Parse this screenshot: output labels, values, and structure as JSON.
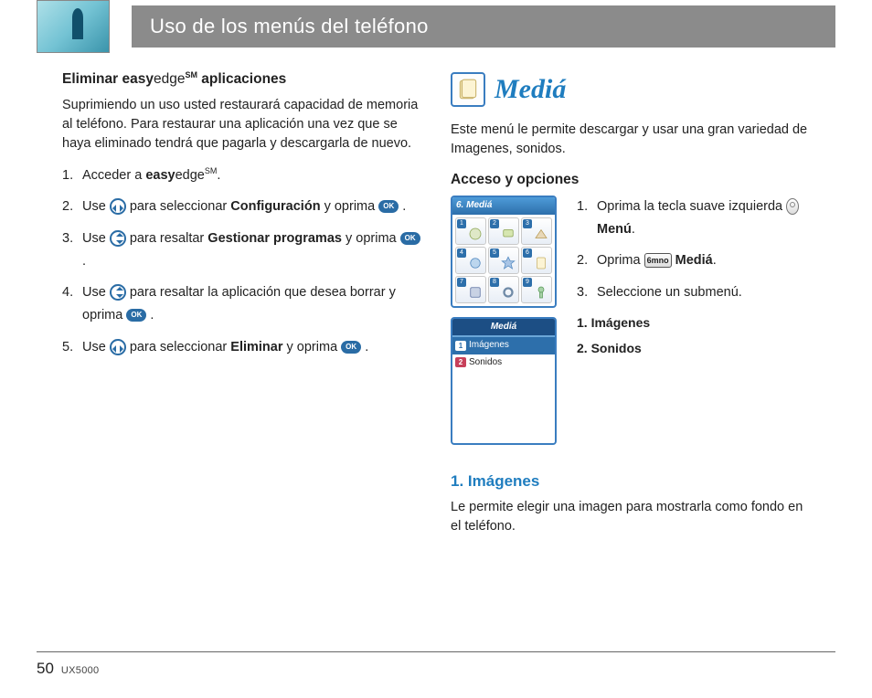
{
  "header": {
    "title": "Uso de los menús del teléfono"
  },
  "left": {
    "heading_pre": "Eliminar ",
    "heading_bold": "easy",
    "heading_light": "edge",
    "heading_sm": "SM",
    "heading_post": " aplicaciones",
    "intro": "Suprimiendo un uso usted restaurará capacidad de memoria al teléfono. Para restaurar una aplicación una vez que se haya eliminado tendrá que pagarla y descargarla de nuevo.",
    "steps": {
      "s1_a": "Acceder a ",
      "s1_bold": "easy",
      "s1_light": "edge",
      "s1_sm": "SM",
      "s1_end": ".",
      "s2_a": "Use ",
      "s2_b": " para seleccionar ",
      "s2_bold": "Configuración",
      "s2_c": " y oprima ",
      "s2_end": ".",
      "s3_a": "Use ",
      "s3_b": " para resaltar ",
      "s3_bold": "Gestionar programas",
      "s3_c": " y oprima ",
      "s3_end": ".",
      "s4_a": "Use ",
      "s4_b": " para resaltar la aplicación que desea borrar y oprima ",
      "s4_end": ".",
      "s5_a": "Use ",
      "s5_b": " para seleccionar ",
      "s5_bold": "Eliminar",
      "s5_c": " y oprima ",
      "s5_end": "."
    }
  },
  "right": {
    "media_title": "Mediá",
    "intro": "Este menú le permite descargar y usar una gran variedad de Imagenes, sonidos.",
    "access_heading": "Acceso y opciones",
    "screen1_title": "6. Mediá",
    "screen2_title": "Mediá",
    "screen2_items": {
      "i1": "Imágenes",
      "i2": "Sonidos"
    },
    "steps": {
      "s1_a": "Oprima la tecla suave izquierda ",
      "s1_bold": "Menú",
      "s1_end": ".",
      "s2_a": "Oprima ",
      "s2_key": "6mno",
      "s2_bold": "Mediá",
      "s2_end": ".",
      "s3": "Seleccione un submenú."
    },
    "submenu": {
      "i1": "1. Imágenes",
      "i2": "2. Sonidos"
    },
    "section1_heading": "1. Imágenes",
    "section1_body": "Le permite elegir una imagen para mostrarla como fondo en el teléfono."
  },
  "footer": {
    "page": "50",
    "model": "UX5000"
  },
  "ok_label": "OK"
}
